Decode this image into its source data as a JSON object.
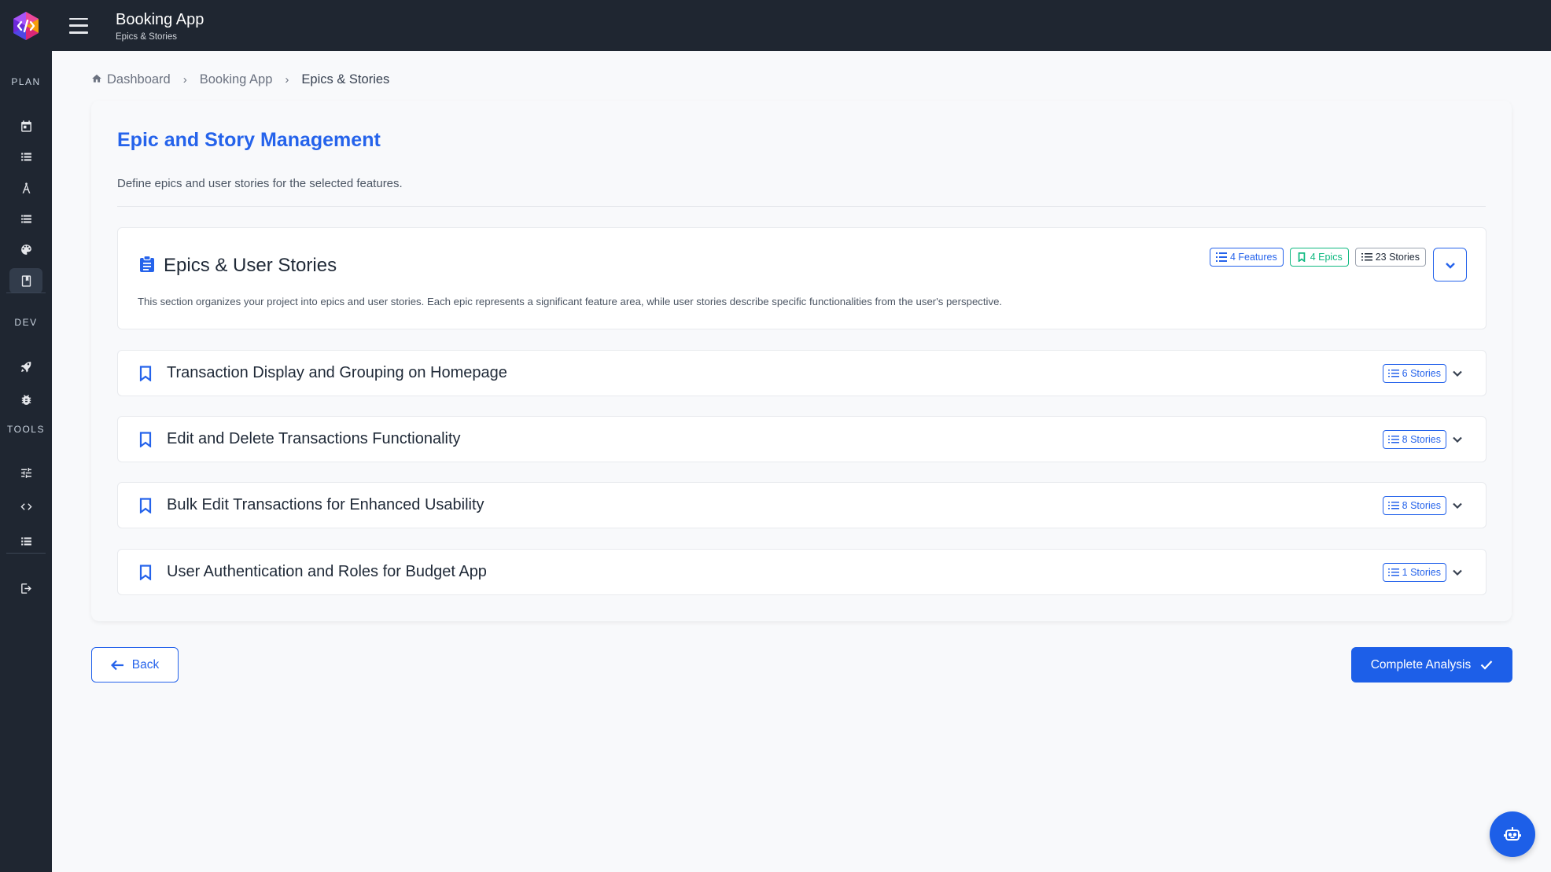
{
  "header": {
    "app_title": "Booking App",
    "subtitle": "Epics & Stories"
  },
  "sidebar": {
    "sections": [
      "PLAN",
      "DEV",
      "TOOLS"
    ],
    "plan_icons": [
      "calendar-icon",
      "list-icon",
      "compass-icon",
      "list-alt-icon",
      "palette-icon",
      "book-icon"
    ],
    "dev_icons": [
      "rocket-icon",
      "bug-icon"
    ],
    "tools_icons": [
      "sliders-icon",
      "code-icon",
      "list-icon"
    ],
    "bottom_icons": [
      "logout-icon"
    ],
    "active": "book-icon"
  },
  "breadcrumb": {
    "items": [
      "Dashboard",
      "Booking App",
      "Epics & Stories"
    ]
  },
  "main": {
    "title": "Epic and Story Management",
    "description": "Define epics and user stories for the selected features."
  },
  "overview": {
    "title": "Epics & User Stories",
    "description": "This section organizes your project into epics and user stories. Each epic represents a significant feature area, while user stories describe specific functionalities from the user's perspective.",
    "badges": {
      "features": "4 Features",
      "epics": "4 Epics",
      "stories": "23 Stories"
    }
  },
  "epics": [
    {
      "title": "Transaction Display and Grouping on Homepage",
      "stories": "6 Stories"
    },
    {
      "title": "Edit and Delete Transactions Functionality",
      "stories": "8 Stories"
    },
    {
      "title": "Bulk Edit Transactions for Enhanced Usability",
      "stories": "8 Stories"
    },
    {
      "title": "User Authentication and Roles for Budget App",
      "stories": "1 Stories"
    }
  ],
  "actions": {
    "back": "Back",
    "complete": "Complete Analysis"
  },
  "colors": {
    "accent": "#2563eb",
    "sidebar_bg": "#1f2631",
    "epics_badge": "#10b981"
  }
}
